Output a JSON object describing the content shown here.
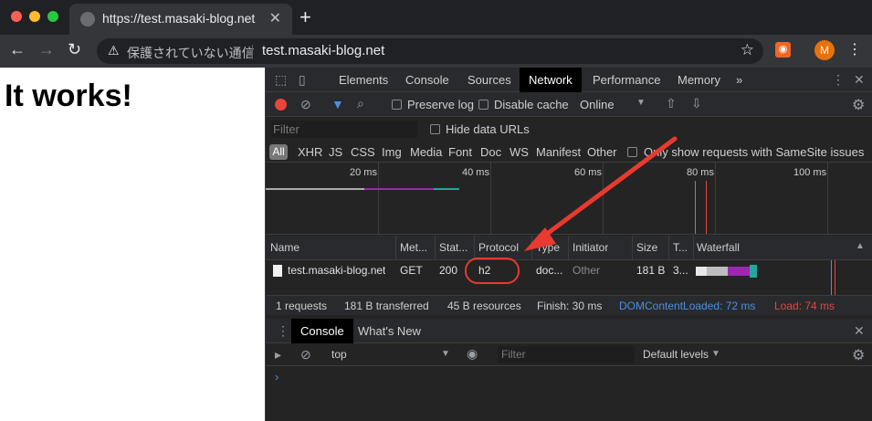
{
  "browser": {
    "tab_title": "https://test.masaki-blog.net",
    "security_text": "保護されていない通信",
    "url": "test.masaki-blog.net",
    "avatar_initial": "M"
  },
  "page": {
    "heading": "It works!"
  },
  "devtools": {
    "tabs": [
      "Elements",
      "Console",
      "Sources",
      "Network",
      "Performance",
      "Memory"
    ],
    "active_tab": "Network",
    "more": "»",
    "toolbar": {
      "preserve_log": "Preserve log",
      "disable_cache": "Disable cache",
      "throttle": "Online"
    },
    "filter": {
      "placeholder": "Filter",
      "hide_data_urls": "Hide data URLs"
    },
    "types": [
      "All",
      "XHR",
      "JS",
      "CSS",
      "Img",
      "Media",
      "Font",
      "Doc",
      "WS",
      "Manifest",
      "Other"
    ],
    "samesite": "Only show requests with SameSite issues",
    "timeline_ticks": [
      "20 ms",
      "40 ms",
      "60 ms",
      "80 ms",
      "100 ms"
    ],
    "columns": [
      "Name",
      "Met...",
      "Stat...",
      "Protocol",
      "Type",
      "Initiator",
      "Size",
      "T...",
      "Waterfall"
    ],
    "row": {
      "name": "test.masaki-blog.net",
      "method": "GET",
      "status": "200",
      "protocol": "h2",
      "type": "doc...",
      "initiator": "Other",
      "size": "181 B",
      "time": "3..."
    },
    "summary": {
      "requests": "1 requests",
      "transferred": "181 B transferred",
      "resources": "45 B resources",
      "finish": "Finish: 30 ms",
      "dcl": "DOMContentLoaded: 72 ms",
      "load": "Load: 74 ms"
    },
    "drawer": {
      "tabs": [
        "Console",
        "What's New"
      ],
      "context": "top",
      "filter_placeholder": "Filter",
      "levels": "Default levels"
    },
    "colors": {
      "accent": "#1a73e8",
      "dcl": "#4a90e2",
      "load": "#e8453c",
      "annotation": "#e83a2e"
    }
  }
}
